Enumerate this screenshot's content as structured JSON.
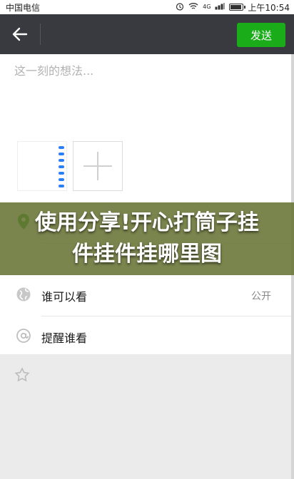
{
  "status_bar": {
    "carrier": "中国电信",
    "network": "4G",
    "time": "上午10:54"
  },
  "header": {
    "send_label": "发送"
  },
  "composer": {
    "placeholder": "这一刻的想法...",
    "thumbnail_rows": [
      "",
      "",
      "",
      "",
      "",
      "",
      "",
      ""
    ]
  },
  "options": [
    {
      "label": "谁可以看",
      "value": "公开",
      "icon": "globe-icon"
    },
    {
      "label": "提醒谁看",
      "value": "",
      "icon": "at-icon"
    }
  ],
  "overlay": {
    "title": "使用分享!开心打筒子挂件挂件挂哪里图"
  },
  "colors": {
    "header_bg": "#393a3f",
    "send_button": "#1aad19",
    "overlay": "#687334"
  }
}
